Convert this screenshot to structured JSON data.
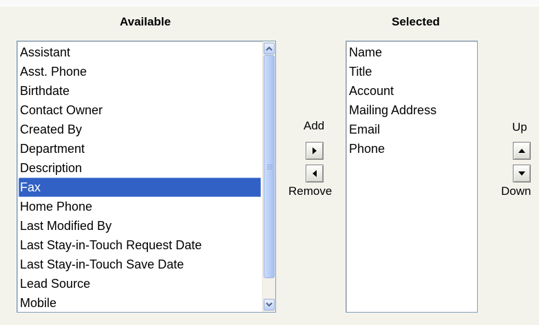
{
  "available": {
    "header": "Available",
    "items": [
      "Assistant",
      "Asst. Phone",
      "Birthdate",
      "Contact Owner",
      "Created By",
      "Department",
      "Description",
      "Fax",
      "Home Phone",
      "Last Modified By",
      "Last Stay-in-Touch Request Date",
      "Last Stay-in-Touch Save Date",
      "Lead Source",
      "Mobile"
    ],
    "selected_item": "Fax"
  },
  "selected": {
    "header": "Selected",
    "items": [
      "Name",
      "Title",
      "Account",
      "Mailing Address",
      "Email",
      "Phone"
    ]
  },
  "controls": {
    "add_label": "Add",
    "remove_label": "Remove",
    "up_label": "Up",
    "down_label": "Down",
    "icons": {
      "add": "arrow-right-icon",
      "remove": "arrow-left-icon",
      "up": "arrow-up-icon",
      "down": "arrow-down-icon"
    }
  },
  "colors": {
    "selection": "#3161c5",
    "panel_bg": "#f3f3ec"
  }
}
